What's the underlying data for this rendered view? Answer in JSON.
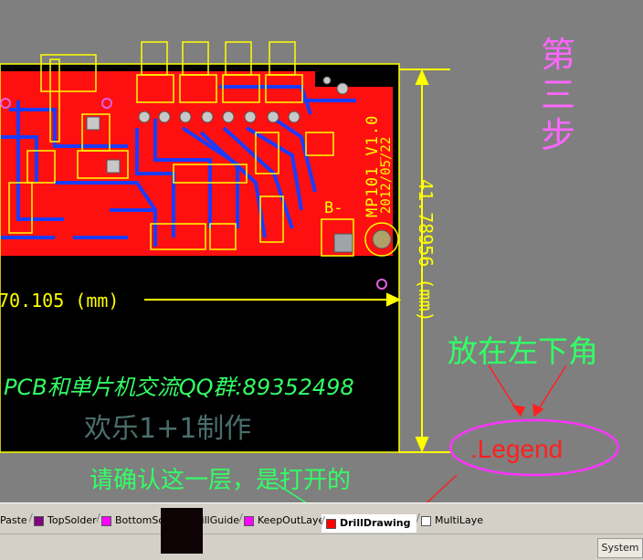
{
  "pcb": {
    "board_name": "MP101_V1.0",
    "board_date": "2012/05/22",
    "b_minus_label": "B-",
    "width_dim": "70.105 (mm)",
    "height_dim": "41.78956 (mm)",
    "group_text": "PCB和单片机交流QQ群:89352498",
    "fun_text": "欢乐1+1制作"
  },
  "annotations": {
    "step": "第\n三\n步",
    "place_corner": "放在左下角",
    "confirm_layer": "请确认这一层，是打开的",
    "legend_label": ".Legend"
  },
  "layer_tabs": [
    {
      "label": "Paste",
      "color": "#7f7f7f"
    },
    {
      "label": "TopSolder",
      "color": "#800080"
    },
    {
      "label": "BottomSolder",
      "color": "#ff00ff"
    },
    {
      "label": "DrillGuide",
      "color": "#ff00ff"
    },
    {
      "label": "KeepOutLayer",
      "color": "#ff00ff"
    },
    {
      "label": "DrillDrawing",
      "color": "#ff0000",
      "active": true
    },
    {
      "label": "MultiLayer",
      "color": "#ffffff"
    }
  ],
  "status": {
    "system_button": "System"
  },
  "colors": {
    "workspace": "#7f7f7f",
    "board_black": "#000000",
    "copper_red": "#ff0000",
    "trace_blue": "#1a3cff",
    "overlay_yellow": "#ffff00",
    "annotation_green": "#33ff66",
    "annotation_pink": "#ff33ff",
    "annotation_arrow": "#ff2020"
  }
}
